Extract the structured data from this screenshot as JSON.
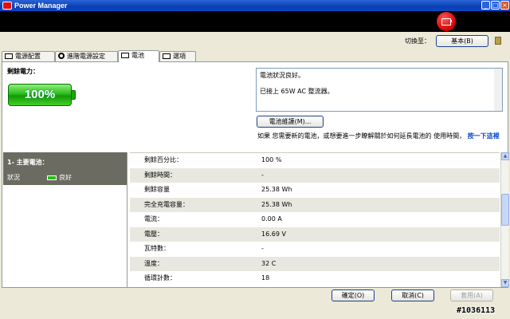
{
  "window": {
    "title": "Power Manager"
  },
  "switch": {
    "label": "切換至：",
    "button": "基本(B)"
  },
  "tabs": [
    {
      "label": "電源配置"
    },
    {
      "label": "進階電源設定"
    },
    {
      "label": "電池"
    },
    {
      "label": "選項"
    }
  ],
  "summary": {
    "remaining_label": "剩餘電力：",
    "percent": "100%",
    "status_lines": [
      "電池狀況良好。",
      "已接上 65W AC 整流器。"
    ],
    "maintenance_button": "電池維護(M)...",
    "info_text": "如果 您需要新的電池，或想要進一步瞭解關於如何延長電池的 使用時間，",
    "info_link": "按一下這裡"
  },
  "battery": {
    "name": "1- 主要電池：",
    "status_label": "狀況",
    "status_value": "良好"
  },
  "details": [
    {
      "key": "剩餘百分比：",
      "value": "100 %"
    },
    {
      "key": "剩餘時間：",
      "value": "-"
    },
    {
      "key": "剩餘容量",
      "value": "25.38 Wh"
    },
    {
      "key": "完全充電容量：",
      "value": "25.38 Wh"
    },
    {
      "key": "電流：",
      "value": "0.00 A"
    },
    {
      "key": "電壓：",
      "value": "16.69 V"
    },
    {
      "key": "瓦特數：",
      "value": "-"
    },
    {
      "key": "溫度：",
      "value": "32 C"
    },
    {
      "key": "循環計數：",
      "value": "18"
    }
  ],
  "buttons": {
    "ok": "確定(O)",
    "cancel": "取消(C)",
    "apply": "套用(A)"
  },
  "watermark": "#1036113",
  "colors": {
    "accent": "#0a48c8",
    "battery_green": "#2cbb1c",
    "badge_red": "#d10000"
  }
}
